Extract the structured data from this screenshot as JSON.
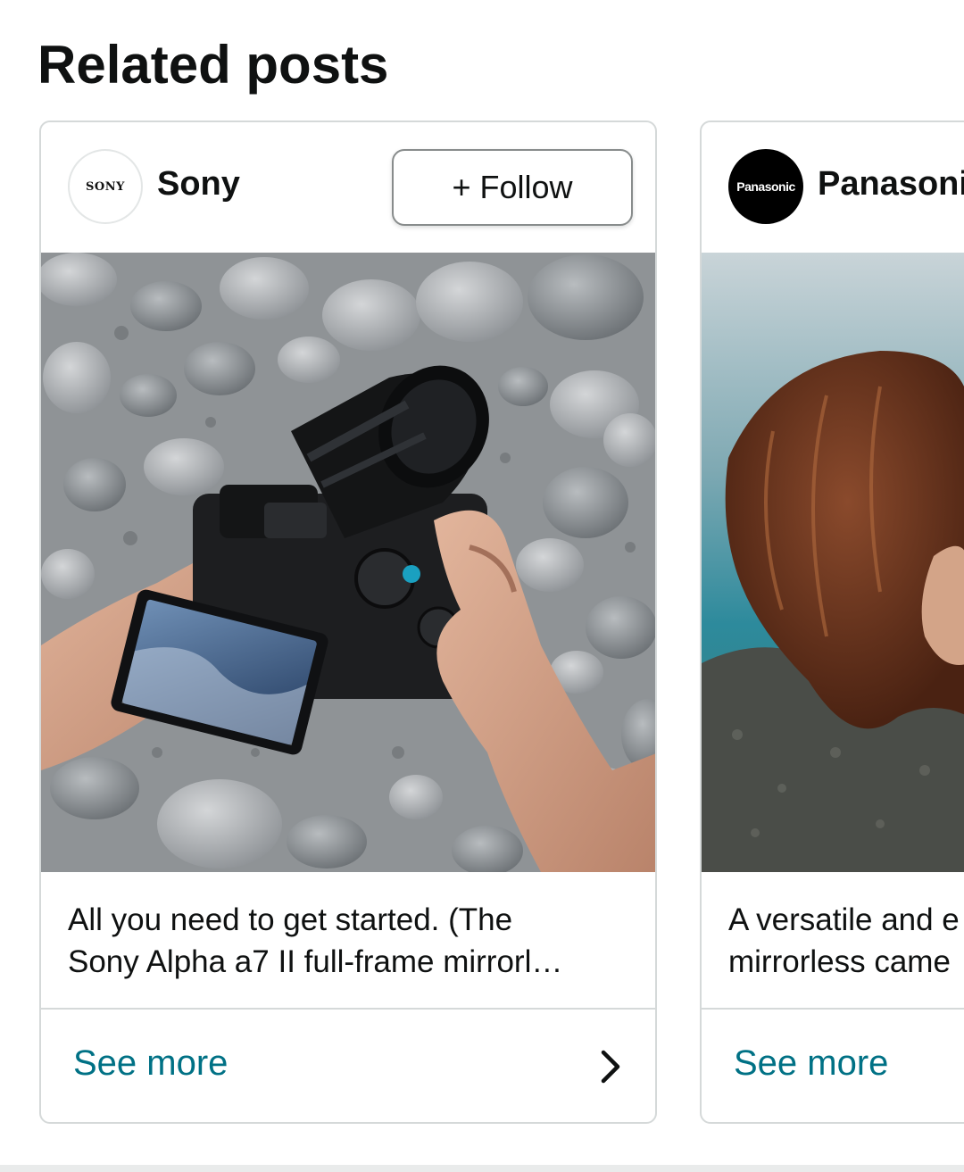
{
  "section": {
    "title": "Related posts"
  },
  "posts": [
    {
      "brand": "Sony",
      "avatar_text": "SONY",
      "follow_label": "+ Follow",
      "image_icon": "camera-photo",
      "caption_lines": [
        "All you need to get started. (The",
        "Sony Alpha a7 II full-frame mirrorl…"
      ],
      "see_more": "See more"
    },
    {
      "brand": "Panasonic",
      "avatar_text": "Panasonic",
      "image_icon": "portrait-photo",
      "caption_lines": [
        "A versatile and e",
        "mirrorless came"
      ],
      "see_more": "See more"
    }
  ],
  "colors": {
    "link": "#007185",
    "border": "#d5d9d9",
    "text": "#0f1111"
  }
}
